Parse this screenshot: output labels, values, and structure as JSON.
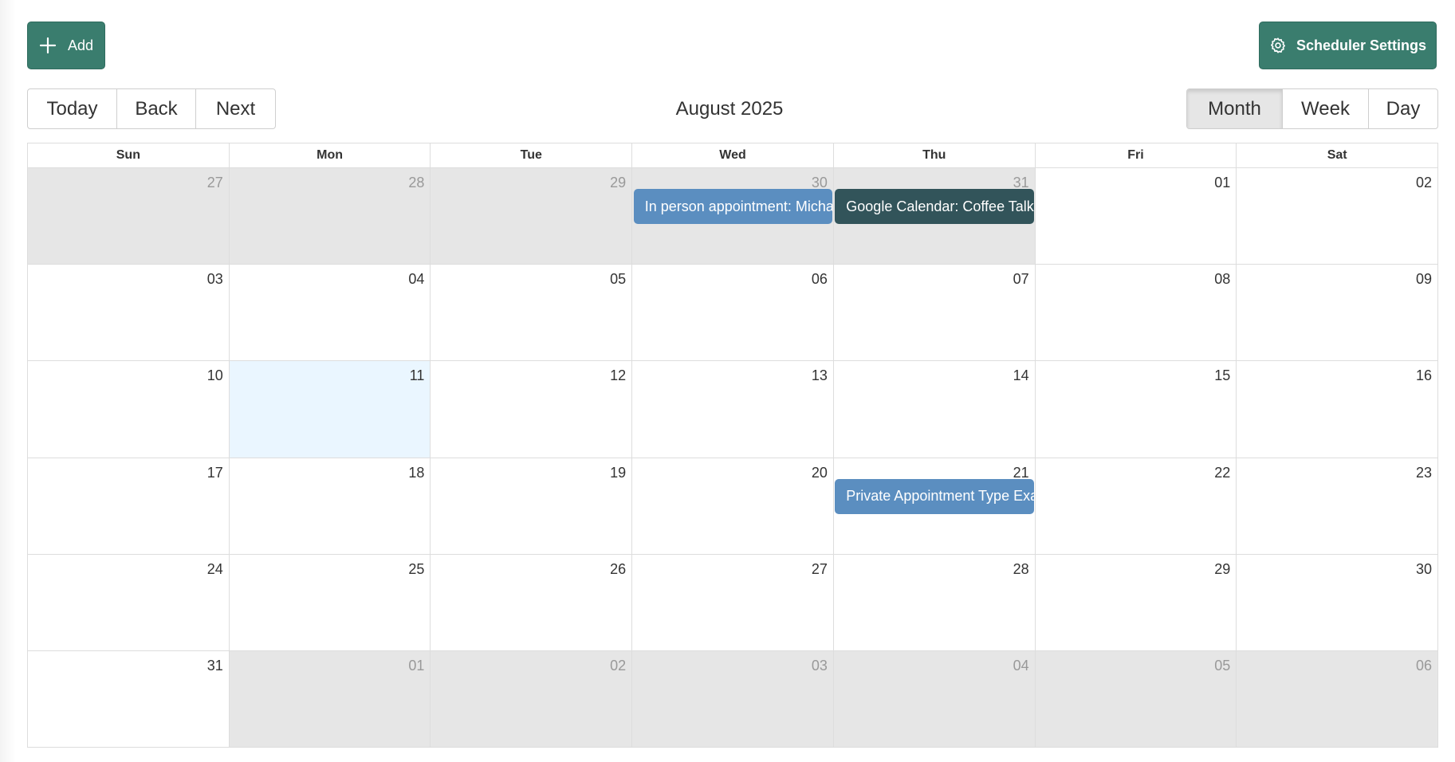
{
  "toolbar": {
    "add_label": "Add",
    "settings_label": "Scheduler Settings",
    "nav": [
      "Today",
      "Back",
      "Next"
    ],
    "title": "August 2025",
    "views": [
      "Month",
      "Week",
      "Day"
    ],
    "active_view": "Month"
  },
  "calendar": {
    "weekdays": [
      "Sun",
      "Mon",
      "Tue",
      "Wed",
      "Thu",
      "Fri",
      "Sat"
    ],
    "weeks": [
      [
        {
          "d": "27",
          "off": true
        },
        {
          "d": "28",
          "off": true
        },
        {
          "d": "29",
          "off": true
        },
        {
          "d": "30",
          "off": true
        },
        {
          "d": "31",
          "off": true
        },
        {
          "d": "01"
        },
        {
          "d": "02"
        }
      ],
      [
        {
          "d": "03"
        },
        {
          "d": "04"
        },
        {
          "d": "05"
        },
        {
          "d": "06"
        },
        {
          "d": "07"
        },
        {
          "d": "08"
        },
        {
          "d": "09"
        }
      ],
      [
        {
          "d": "10"
        },
        {
          "d": "11",
          "today": true
        },
        {
          "d": "12"
        },
        {
          "d": "13"
        },
        {
          "d": "14"
        },
        {
          "d": "15"
        },
        {
          "d": "16"
        }
      ],
      [
        {
          "d": "17"
        },
        {
          "d": "18"
        },
        {
          "d": "19"
        },
        {
          "d": "20"
        },
        {
          "d": "21"
        },
        {
          "d": "22"
        },
        {
          "d": "23"
        }
      ],
      [
        {
          "d": "24"
        },
        {
          "d": "25"
        },
        {
          "d": "26"
        },
        {
          "d": "27"
        },
        {
          "d": "28"
        },
        {
          "d": "29"
        },
        {
          "d": "30"
        }
      ],
      [
        {
          "d": "31"
        },
        {
          "d": "01",
          "off": true
        },
        {
          "d": "02",
          "off": true
        },
        {
          "d": "03",
          "off": true
        },
        {
          "d": "04",
          "off": true
        },
        {
          "d": "05",
          "off": true
        },
        {
          "d": "06",
          "off": true
        }
      ]
    ],
    "events": [
      {
        "week": 0,
        "day": 3,
        "title": "In person appointment: Michael",
        "color": "#5b8ec0"
      },
      {
        "week": 0,
        "day": 4,
        "title": "Google Calendar: Coffee Talk",
        "color": "#32545a"
      },
      {
        "week": 3,
        "day": 4,
        "title": "Private Appointment Type Example",
        "color": "#5b8ec0"
      }
    ]
  },
  "colors": {
    "primary": "#3a7d6e",
    "off_range_bg": "#e6e6e6",
    "today_bg": "#eaf6ff"
  },
  "icons": {
    "add": "plus-icon",
    "settings": "gear-icon"
  }
}
